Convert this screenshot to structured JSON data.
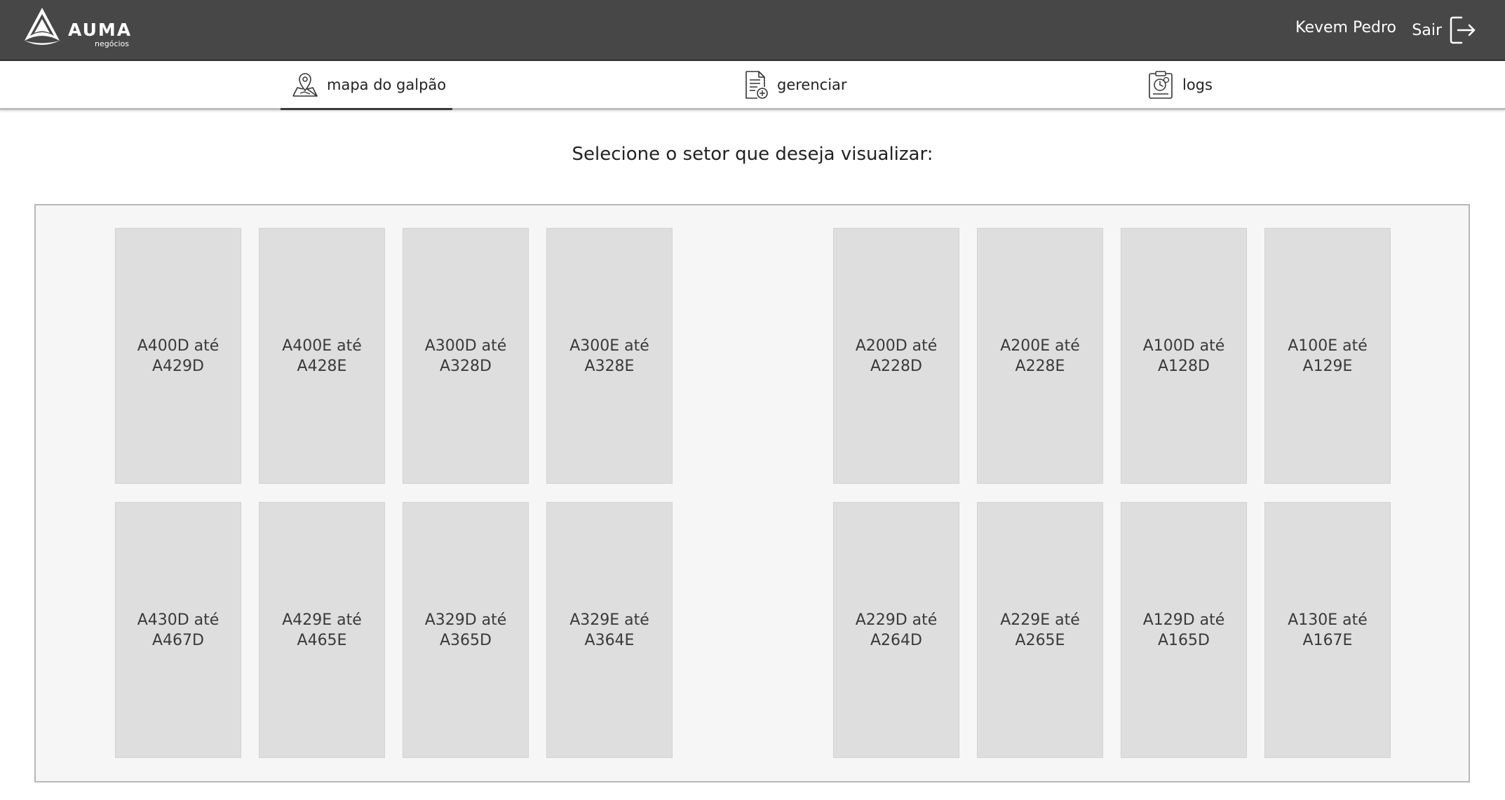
{
  "header": {
    "logo_text": "AUMA",
    "logo_subtext": "negócios",
    "user_name": "Kevem Pedro",
    "logout_label": "Sair"
  },
  "nav": {
    "tabs": [
      {
        "label": "mapa do galpão",
        "icon": "map-pin-icon",
        "active": true
      },
      {
        "label": "gerenciar",
        "icon": "document-add-icon",
        "active": false
      },
      {
        "label": "logs",
        "icon": "clipboard-clock-icon",
        "active": false
      }
    ]
  },
  "main": {
    "instruction": "Selecione o setor que deseja visualizar:",
    "sectors": [
      "A400D até A429D",
      "A400E até A428E",
      "A300D até A328D",
      "A300E até A328E",
      "A200D até A228D",
      "A200E até A228E",
      "A100D até A128D",
      "A100E até A129E",
      "A430D até A467D",
      "A429E até A465E",
      "A329D até A365D",
      "A329E até A364E",
      "A229D até A264D",
      "A229E até A265E",
      "A129D até A165D",
      "A130E até A167E"
    ]
  },
  "colors": {
    "header_bg": "#474747",
    "sector_bg": "#dedede",
    "map_bg": "#f6f6f6",
    "active_tab_underline": "#3a3a3a"
  }
}
